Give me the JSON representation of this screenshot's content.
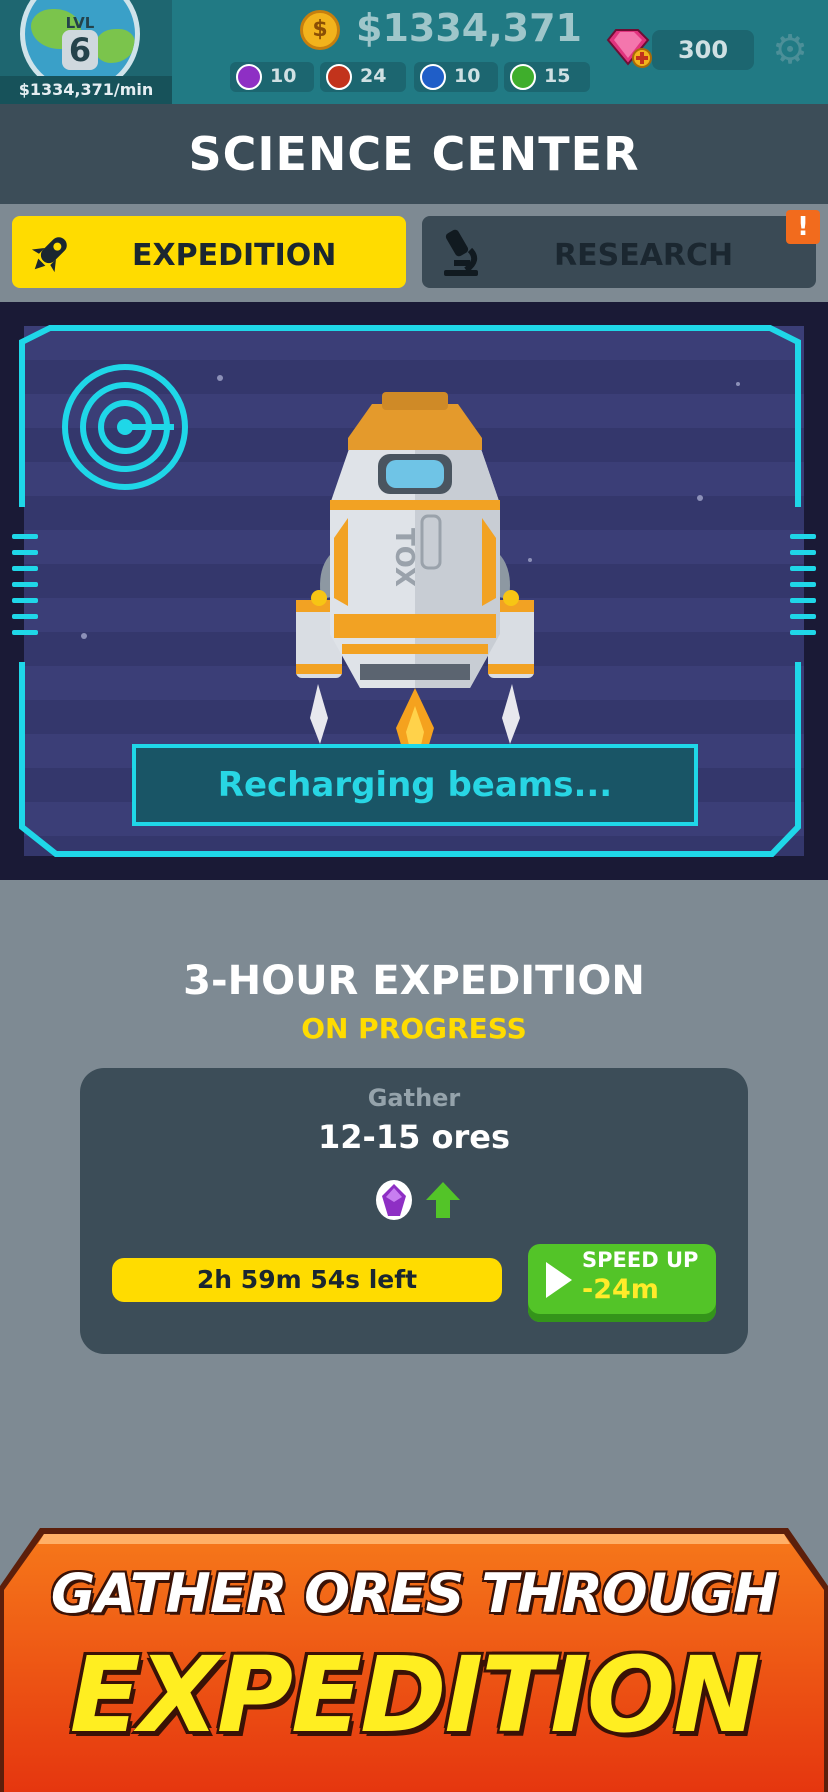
{
  "hud": {
    "level_label": "LVL",
    "level": "6",
    "income_rate": "$1334,371/min",
    "money": "$1334,371",
    "coin_symbol": "$",
    "ores": [
      {
        "color": "#8e2fc4",
        "count": "10"
      },
      {
        "color": "#c2331c",
        "count": "24"
      },
      {
        "color": "#1f5ec8",
        "count": "10"
      },
      {
        "color": "#3fae2c",
        "count": "15"
      }
    ],
    "gems": "300"
  },
  "header": {
    "title": "SCIENCE CENTER"
  },
  "tabs": {
    "expedition": "EXPEDITION",
    "research": "RESEARCH",
    "alert": "!"
  },
  "scanner": {
    "status": "Recharging beams...",
    "rocket_text": "TOX"
  },
  "expedition": {
    "title": "3-HOUR EXPEDITION",
    "status": "ON PROGRESS",
    "gather_label": "Gather",
    "gather_value": "12-15 ores",
    "time_left": "2h 59m 54s left",
    "speed_up_label": "SPEED UP",
    "speed_up_value": "-24m"
  },
  "banner": {
    "line1": "GATHER ORES THROUGH",
    "line2": "EXPEDITION"
  },
  "colors": {
    "accent_yellow": "#ffdc00",
    "neon_cyan": "#1fd7e8",
    "button_green": "#53c428",
    "banner_orange": "#f05a12"
  }
}
